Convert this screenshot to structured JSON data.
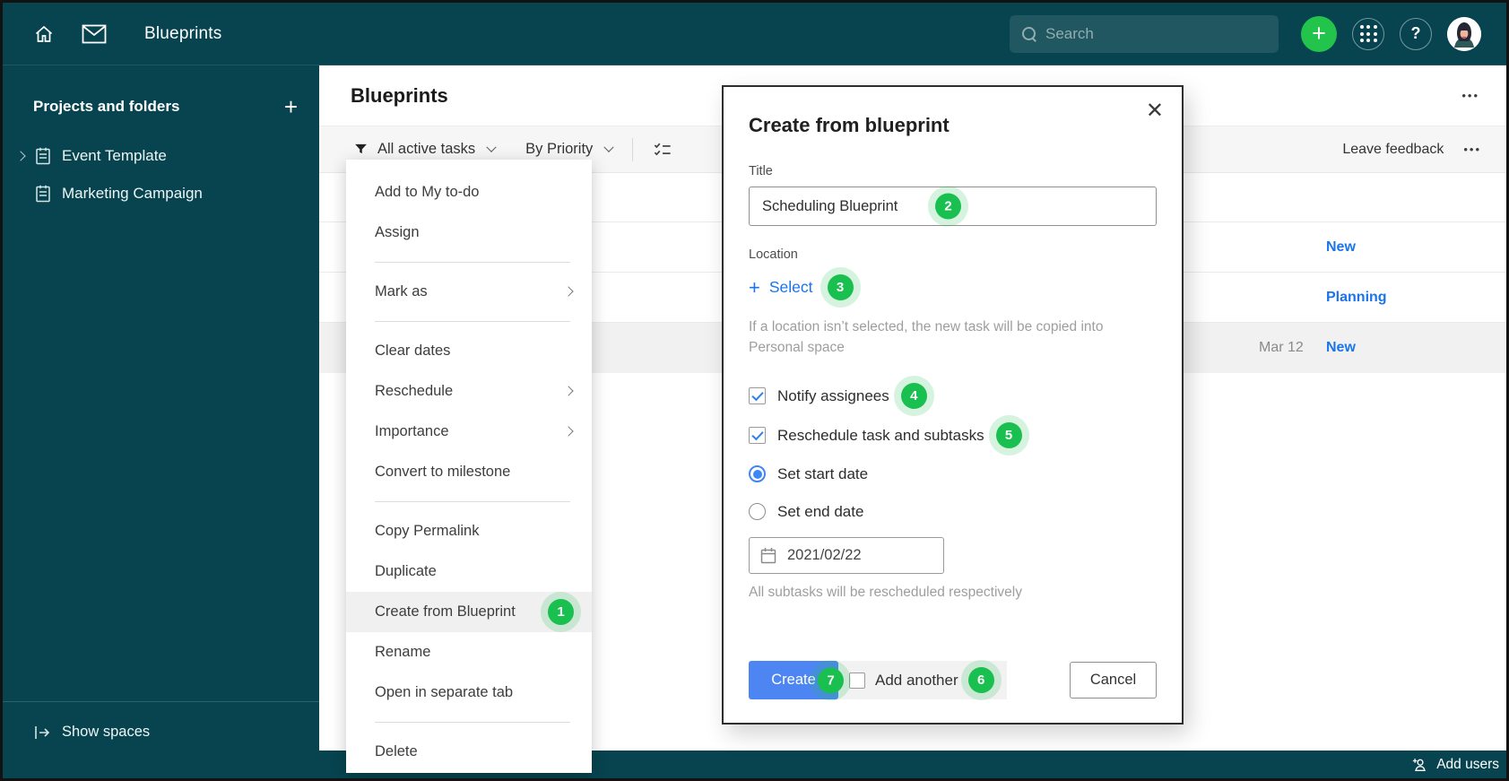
{
  "colors": {
    "teal_chrome": "#07444f",
    "annotation_green": "#19bf4f",
    "plus_green": "#22c44c",
    "link_blue": "#1b74e8",
    "create_button_blue": "#4d86f3",
    "selected_row_gray": "#f1f1f1"
  },
  "topbar": {
    "app_title": "Blueprints",
    "plus_glyph": "+",
    "help_glyph": "?",
    "search": {
      "placeholder": "Search"
    }
  },
  "sidebar": {
    "section_title": "Projects and folders",
    "add_glyph": "+",
    "items": [
      {
        "label": "Event Template",
        "expandable": true
      },
      {
        "label": "Marketing Campaign",
        "expandable": false
      }
    ],
    "show_spaces_label": "Show spaces"
  },
  "content": {
    "title": "Blueprints",
    "more": "•••",
    "toolbar": {
      "filter_label": "All active tasks",
      "group_label": "By Priority",
      "leave_feedback_label": "Leave feedback",
      "more": "•••"
    },
    "rows": [
      {
        "date": "",
        "status": ""
      },
      {
        "date": "",
        "status": "New"
      },
      {
        "date": "",
        "status": "Planning"
      },
      {
        "date": "Mar 12",
        "status": "New",
        "selected": true
      }
    ]
  },
  "context_menu": {
    "items": [
      {
        "label": "Add to My to-do"
      },
      {
        "label": "Assign"
      },
      {
        "label": "Mark as",
        "submenu": true
      },
      {
        "label": "Clear dates"
      },
      {
        "label": "Reschedule",
        "submenu": true
      },
      {
        "label": "Importance",
        "submenu": true
      },
      {
        "label": "Convert to milestone"
      },
      {
        "label": "Copy Permalink"
      },
      {
        "label": "Duplicate"
      },
      {
        "label": "Create from Blueprint",
        "badge": "1",
        "highlighted": true
      },
      {
        "label": "Rename"
      },
      {
        "label": "Open in separate tab"
      },
      {
        "label": "Delete"
      }
    ]
  },
  "modal": {
    "title": "Create from blueprint",
    "close_glyph": "✕",
    "title_field": {
      "label": "Title",
      "value": "Scheduling Blueprint",
      "badge": "2"
    },
    "location": {
      "label": "Location",
      "plus_glyph": "+",
      "select_label": "Select",
      "badge": "3",
      "helper": "If a location isn’t selected, the new task will be copied into Personal space"
    },
    "options": [
      {
        "label": "Notify assignees",
        "badge": "4",
        "checked": true
      },
      {
        "label": "Reschedule task and subtasks",
        "badge": "5",
        "checked": true
      }
    ],
    "date_modes": [
      {
        "label": "Set start date",
        "selected": true
      },
      {
        "label": "Set end date",
        "selected": false
      }
    ],
    "date_field": {
      "value": "2021/02/22"
    },
    "date_helper": "All subtasks will be rescheduled respectively",
    "footer": {
      "create_label": "Create",
      "create_badge": "7",
      "add_another_label": "Add another",
      "add_another_badge": "6",
      "cancel_label": "Cancel"
    }
  },
  "bottom_bar": {
    "add_users_label": "Add users"
  }
}
